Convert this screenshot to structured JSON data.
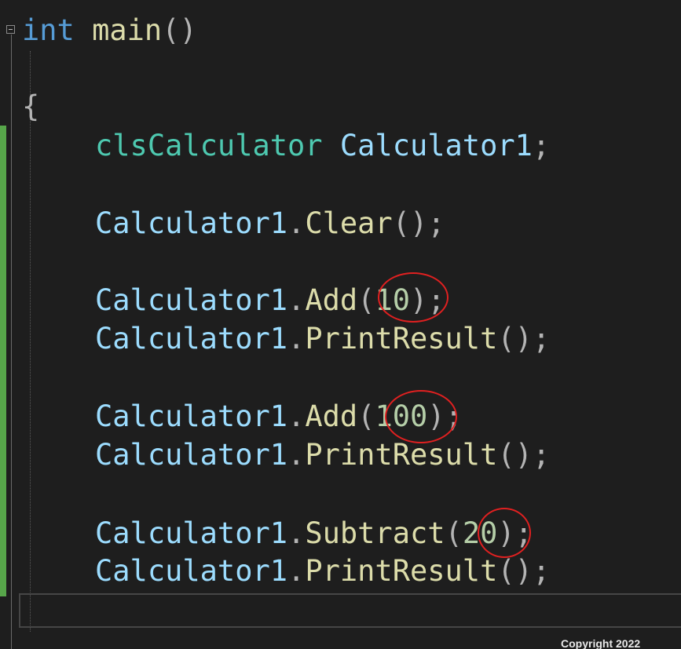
{
  "code": {
    "line_main": {
      "keyword": "int",
      "function": "main",
      "parens": "()"
    },
    "open_brace": "{",
    "declaration": {
      "type": "clsCalculator",
      "variable": "Calculator1",
      "semicolon": ";"
    },
    "calls": [
      {
        "object": "Calculator1",
        "dot": ".",
        "method": "Clear",
        "open": "(",
        "arg": "",
        "close": ")",
        "end": ";"
      },
      {
        "object": "Calculator1",
        "dot": ".",
        "method": "Add",
        "open": "(",
        "arg": "10",
        "close": ")",
        "end": ";"
      },
      {
        "object": "Calculator1",
        "dot": ".",
        "method": "PrintResult",
        "open": "(",
        "arg": "",
        "close": ")",
        "end": ";"
      },
      {
        "object": "Calculator1",
        "dot": ".",
        "method": "Add",
        "open": "(",
        "arg": "100",
        "close": ")",
        "end": ";"
      },
      {
        "object": "Calculator1",
        "dot": ".",
        "method": "PrintResult",
        "open": "(",
        "arg": "",
        "close": ")",
        "end": ";"
      },
      {
        "object": "Calculator1",
        "dot": ".",
        "method": "Subtract",
        "open": "(",
        "arg": "20",
        "close": ")",
        "end": ";"
      },
      {
        "object": "Calculator1",
        "dot": ".",
        "method": "PrintResult",
        "open": "(",
        "arg": "",
        "close": ")",
        "end": ";"
      }
    ]
  },
  "highlighted_args": [
    "10",
    "100",
    "20"
  ],
  "footer": {
    "copyright": "Copyright 2022"
  },
  "colors": {
    "background": "#1e1e1e",
    "keyword": "#569cd6",
    "function": "#dcdcaa",
    "type": "#4ec9b0",
    "variable": "#9cdcfe",
    "number": "#b5cea8",
    "change_bar": "#57a64a",
    "annotation_circle": "#e02020"
  },
  "icons": [
    "fold-toggle-icon"
  ]
}
